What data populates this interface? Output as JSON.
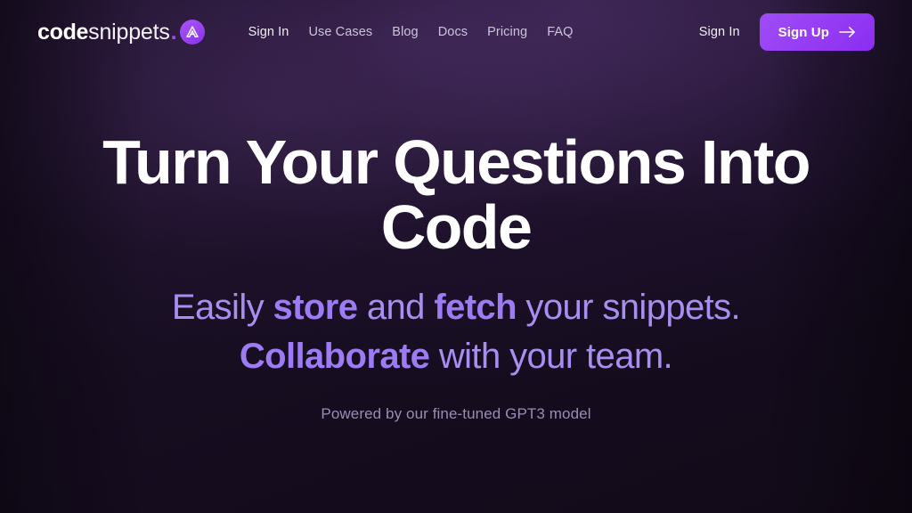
{
  "header": {
    "brand": {
      "code_text": "code",
      "snippets_text": "snippets",
      "dot_text": ".",
      "mark_icon": "logo-peak-icon"
    },
    "nav": [
      {
        "label": "Sign In",
        "name": "nav-link-sign-in",
        "bright": true
      },
      {
        "label": "Use Cases",
        "name": "nav-link-use-cases",
        "bright": false
      },
      {
        "label": "Blog",
        "name": "nav-link-blog",
        "bright": false
      },
      {
        "label": "Docs",
        "name": "nav-link-docs",
        "bright": false
      },
      {
        "label": "Pricing",
        "name": "nav-link-pricing",
        "bright": false
      },
      {
        "label": "FAQ",
        "name": "nav-link-faq",
        "bright": false
      }
    ],
    "actions": {
      "sign_in_label": "Sign In",
      "sign_up_label": "Sign Up",
      "sign_up_icon": "arrow-right-icon"
    }
  },
  "hero": {
    "title": "Turn Your Questions Into Code",
    "subtitle": {
      "line1_part1": "Easily ",
      "line1_accent1": "store",
      "line1_part2": " and ",
      "line1_accent2": "fetch",
      "line1_part3": " your snippets.",
      "line2_accent": "Collaborate",
      "line2_rest": " with your team."
    },
    "note": "Powered by our fine-tuned GPT3 model"
  },
  "theme": {
    "background": "#150c1e",
    "accent_purple": "#8b2ef0",
    "accent_light": "#9d7bf5",
    "text_white": "#ffffff",
    "nav_text": "#cdc4da"
  }
}
